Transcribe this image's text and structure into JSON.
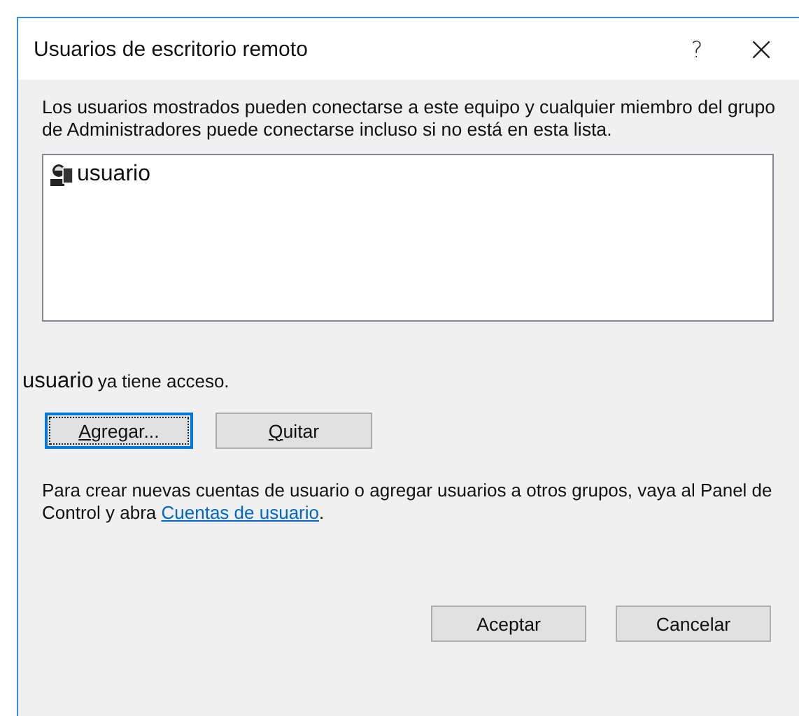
{
  "window": {
    "title": "Usuarios de escritorio remoto",
    "help_glyph": "?",
    "close_glyph": "×"
  },
  "description": "Los usuarios mostrados pueden conectarse a este equipo y cualquier miembro del grupo de Administradores puede conectarse incluso si no está en esta lista.",
  "users": [
    {
      "name": "usuario",
      "selected": false
    }
  ],
  "status": {
    "user_name": "usuario",
    "text": "ya tiene acceso."
  },
  "actions": [
    {
      "label": "Agregar...",
      "mnemonic_underlined": true,
      "focused": true
    },
    {
      "label": "Quitar",
      "mnemonic_underlined": true,
      "focused": false
    }
  ],
  "note": {
    "before": "Para crear nuevas cuentas de usuario o agregar usuarios a otros grupos, vaya al Panel de Control y abra ",
    "link": "Cuentas de usuario",
    "after": "."
  },
  "buttons": [
    {
      "label": "Aceptar",
      "focused": false
    },
    {
      "label": "Cancelar",
      "focused": false
    }
  ]
}
